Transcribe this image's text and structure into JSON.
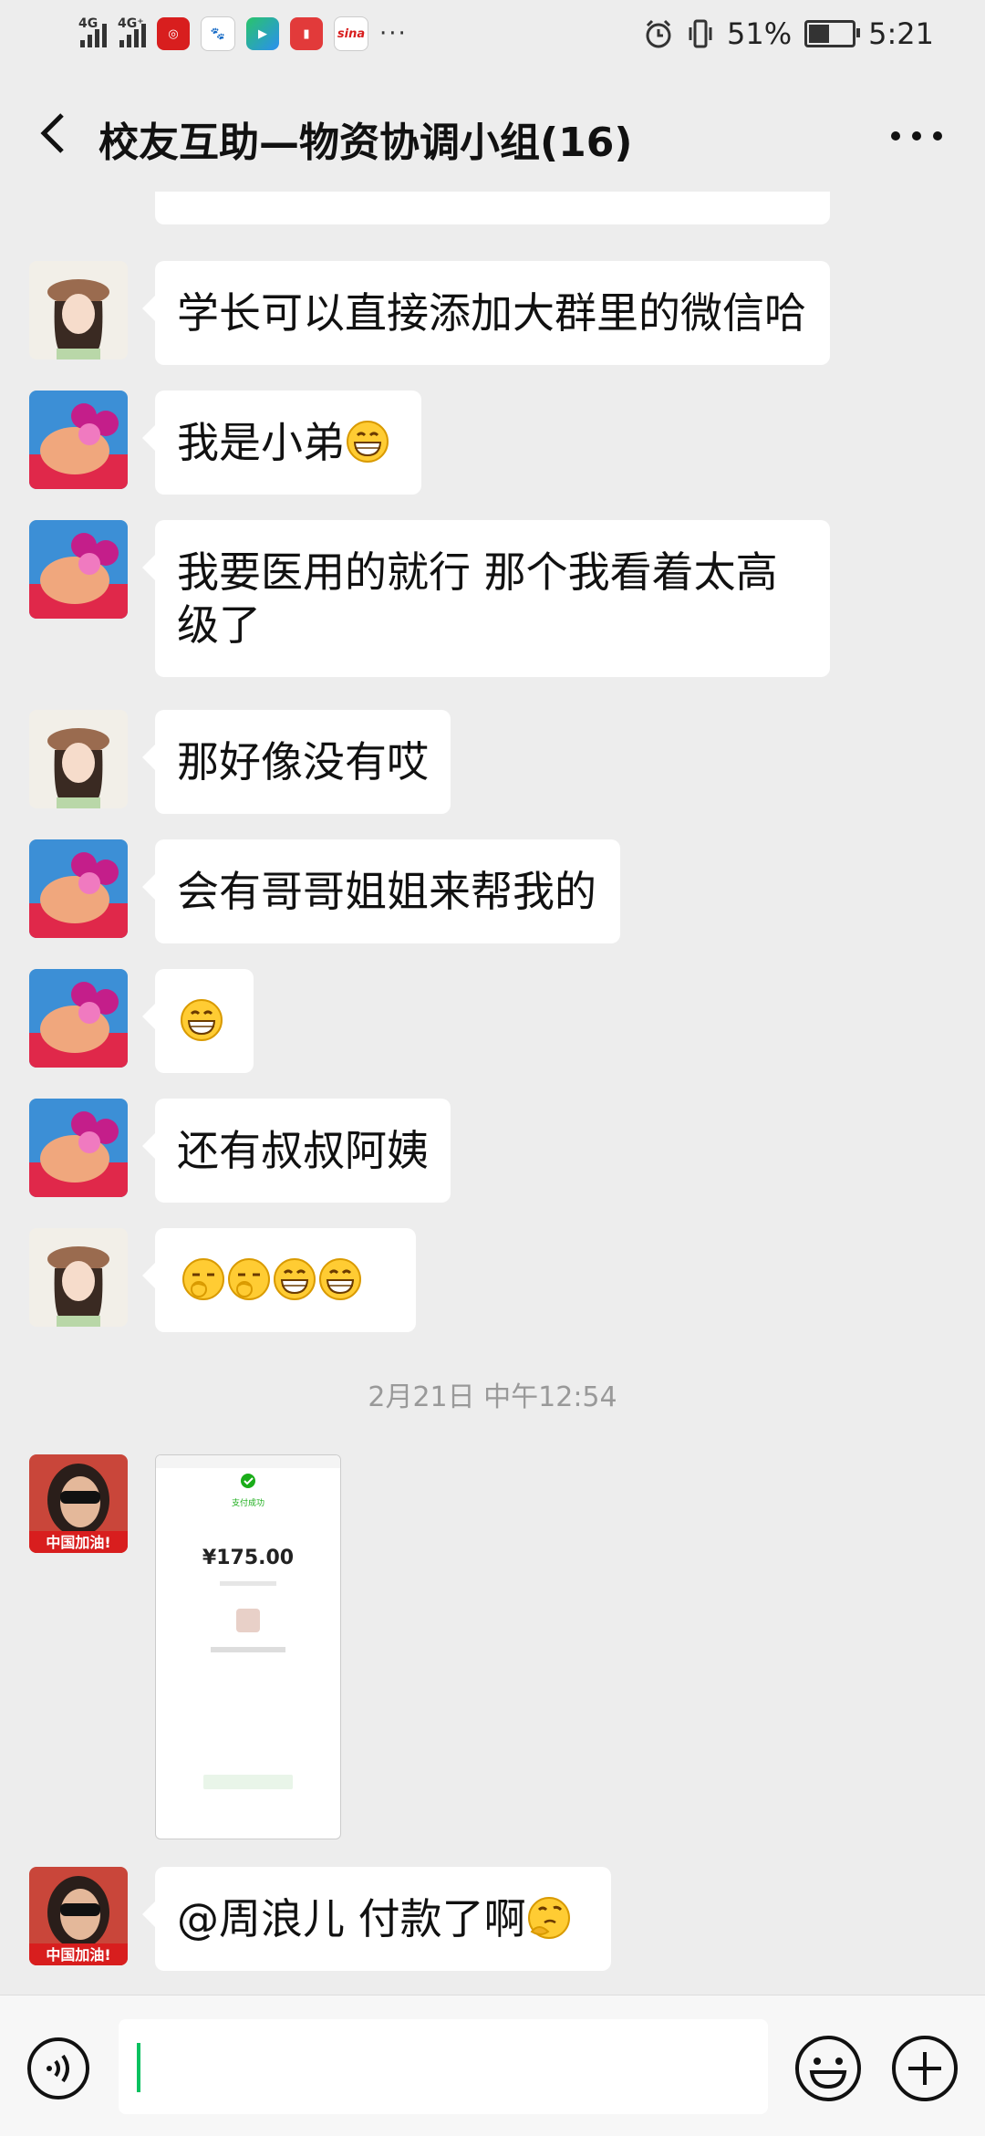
{
  "status_bar": {
    "net1": "4G",
    "net2": "4G⁺",
    "battery_percent": "51%",
    "battery_level": 0.51,
    "time": "5:21",
    "sina_label": "sina",
    "more": "···"
  },
  "header": {
    "title": "校友互助—物资协调小组(16)"
  },
  "messages": [
    {
      "sender": "girl",
      "text": "学长可以直接添加大群里的微信哈"
    },
    {
      "sender": "boy",
      "text": "我是小弟",
      "emoji": [
        "grin"
      ]
    },
    {
      "sender": "boy",
      "text": "我要医用的就行 那个我看着太高级了"
    },
    {
      "sender": "girl",
      "text": "那好像没有哎"
    },
    {
      "sender": "boy",
      "text": "会有哥哥姐姐来帮我的"
    },
    {
      "sender": "boy",
      "text": "",
      "emoji": [
        "grin"
      ]
    },
    {
      "sender": "boy",
      "text": "还有叔叔阿姨"
    },
    {
      "sender": "girl",
      "text": "",
      "emoji": [
        "yawn",
        "yawn",
        "grin",
        "grin"
      ]
    }
  ],
  "timestamp": "2月21日 中午12:54",
  "payment": {
    "status": "支付成功",
    "amount": "¥175.00",
    "avatar_badge": "中国加油!"
  },
  "last_message": {
    "text": "@周浪儿  付款了啊",
    "emoji": [
      "thinking"
    ],
    "avatar_badge": "中国加油!"
  },
  "colors": {
    "background": "#ededed",
    "bubble": "#ffffff",
    "caret": "#07c160"
  }
}
